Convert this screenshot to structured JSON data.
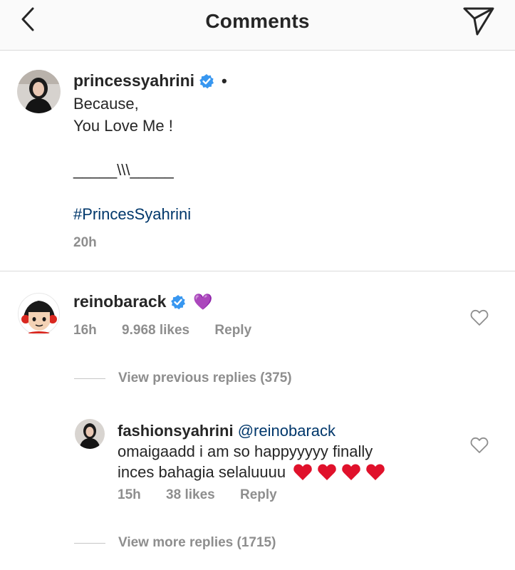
{
  "header": {
    "title": "Comments"
  },
  "post": {
    "username": "princessyahrini",
    "caption_lines": [
      "Because,",
      "You Love Me !",
      "",
      "_____\\\\\\_____",
      ""
    ],
    "hashtag": "#PrincesSyahrini",
    "time": "20h"
  },
  "comment": {
    "username": "reinobarack",
    "emoji": "💜",
    "time": "16h",
    "likes": "9.968 likes",
    "reply_label": "Reply"
  },
  "view_previous": "View previous replies (375)",
  "reply": {
    "username": "fashionsyahrini",
    "mention": "@reinobarack",
    "text_line1": "omaigaadd i am so happyyyyy finally",
    "text_line2": "inces bahagia selaluuuu",
    "time": "15h",
    "likes": "38 likes",
    "reply_label": "Reply"
  },
  "view_more": "View more replies (1715)",
  "colors": {
    "verified": "#3897f0",
    "hashtag": "#00376b",
    "meta": "#8e8e8e",
    "heart_emoji": "#e0112b"
  }
}
